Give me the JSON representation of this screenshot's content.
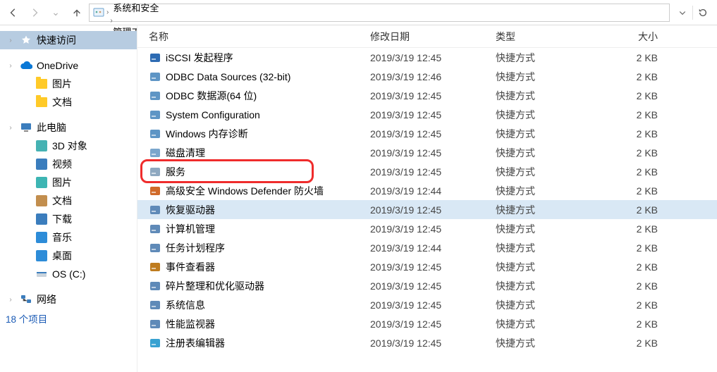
{
  "nav": {
    "back_enabled": true,
    "forward_enabled": false,
    "up_enabled": true,
    "refresh_enabled": true,
    "dropdown": "⌄",
    "crumbs": [
      "控制面板",
      "系统和安全",
      "管理工具"
    ]
  },
  "sidebar": {
    "items": [
      {
        "label": "快速访问",
        "icon": "star",
        "active": true,
        "expandable": true,
        "indent": false
      },
      {
        "label": "",
        "type": "spacer"
      },
      {
        "label": "OneDrive",
        "icon": "onedrive",
        "active": false,
        "expandable": true,
        "indent": false
      },
      {
        "label": "图片",
        "icon": "folder",
        "active": false,
        "expandable": false,
        "indent": true
      },
      {
        "label": "文档",
        "icon": "folder",
        "active": false,
        "expandable": false,
        "indent": true
      },
      {
        "label": "",
        "type": "spacer"
      },
      {
        "label": "此电脑",
        "icon": "pc",
        "active": false,
        "expandable": true,
        "indent": false
      },
      {
        "label": "3D 对象",
        "icon": "3d",
        "active": false,
        "expandable": false,
        "indent": true
      },
      {
        "label": "视频",
        "icon": "video",
        "active": false,
        "expandable": false,
        "indent": true
      },
      {
        "label": "图片",
        "icon": "pictures",
        "active": false,
        "expandable": false,
        "indent": true
      },
      {
        "label": "文档",
        "icon": "docs",
        "active": false,
        "expandable": false,
        "indent": true
      },
      {
        "label": "下载",
        "icon": "downloads",
        "active": false,
        "expandable": false,
        "indent": true
      },
      {
        "label": "音乐",
        "icon": "music",
        "active": false,
        "expandable": false,
        "indent": true
      },
      {
        "label": "桌面",
        "icon": "desktop",
        "active": false,
        "expandable": false,
        "indent": true
      },
      {
        "label": "OS (C:)",
        "icon": "drive",
        "active": false,
        "expandable": false,
        "indent": true
      },
      {
        "label": "",
        "type": "spacer"
      },
      {
        "label": "网络",
        "icon": "network",
        "active": false,
        "expandable": true,
        "indent": false
      }
    ],
    "status": "18 个项目"
  },
  "columns": {
    "name": "名称",
    "date": "修改日期",
    "type": "类型",
    "size": "大小"
  },
  "files": [
    {
      "name": "iSCSI 发起程序",
      "date": "2019/3/19 12:45",
      "type": "快捷方式",
      "size": "2 KB",
      "selected": false,
      "highlighted": false,
      "icon": "shield"
    },
    {
      "name": "ODBC Data Sources (32-bit)",
      "date": "2019/3/19 12:46",
      "type": "快捷方式",
      "size": "2 KB",
      "selected": false,
      "highlighted": false,
      "icon": "tool"
    },
    {
      "name": "ODBC 数据源(64 位)",
      "date": "2019/3/19 12:45",
      "type": "快捷方式",
      "size": "2 KB",
      "selected": false,
      "highlighted": false,
      "icon": "tool"
    },
    {
      "name": "System Configuration",
      "date": "2019/3/19 12:45",
      "type": "快捷方式",
      "size": "2 KB",
      "selected": false,
      "highlighted": false,
      "icon": "config"
    },
    {
      "name": "Windows 内存诊断",
      "date": "2019/3/19 12:45",
      "type": "快捷方式",
      "size": "2 KB",
      "selected": false,
      "highlighted": false,
      "icon": "memory"
    },
    {
      "name": "磁盘清理",
      "date": "2019/3/19 12:45",
      "type": "快捷方式",
      "size": "2 KB",
      "selected": false,
      "highlighted": false,
      "icon": "disk"
    },
    {
      "name": "服务",
      "date": "2019/3/19 12:45",
      "type": "快捷方式",
      "size": "2 KB",
      "selected": false,
      "highlighted": true,
      "icon": "gear"
    },
    {
      "name": "高级安全 Windows Defender 防火墙",
      "date": "2019/3/19 12:44",
      "type": "快捷方式",
      "size": "2 KB",
      "selected": false,
      "highlighted": false,
      "icon": "firewall"
    },
    {
      "name": "恢复驱动器",
      "date": "2019/3/19 12:45",
      "type": "快捷方式",
      "size": "2 KB",
      "selected": true,
      "highlighted": false,
      "icon": "recovery"
    },
    {
      "name": "计算机管理",
      "date": "2019/3/19 12:45",
      "type": "快捷方式",
      "size": "2 KB",
      "selected": false,
      "highlighted": false,
      "icon": "manage"
    },
    {
      "name": "任务计划程序",
      "date": "2019/3/19 12:44",
      "type": "快捷方式",
      "size": "2 KB",
      "selected": false,
      "highlighted": false,
      "icon": "task"
    },
    {
      "name": "事件查看器",
      "date": "2019/3/19 12:45",
      "type": "快捷方式",
      "size": "2 KB",
      "selected": false,
      "highlighted": false,
      "icon": "event"
    },
    {
      "name": "碎片整理和优化驱动器",
      "date": "2019/3/19 12:45",
      "type": "快捷方式",
      "size": "2 KB",
      "selected": false,
      "highlighted": false,
      "icon": "defrag"
    },
    {
      "name": "系统信息",
      "date": "2019/3/19 12:45",
      "type": "快捷方式",
      "size": "2 KB",
      "selected": false,
      "highlighted": false,
      "icon": "info"
    },
    {
      "name": "性能监视器",
      "date": "2019/3/19 12:45",
      "type": "快捷方式",
      "size": "2 KB",
      "selected": false,
      "highlighted": false,
      "icon": "perf"
    },
    {
      "name": "注册表编辑器",
      "date": "2019/3/19 12:45",
      "type": "快捷方式",
      "size": "2 KB",
      "selected": false,
      "highlighted": false,
      "icon": "reg"
    }
  ],
  "icons": {
    "star": "#f2f2f2",
    "onedrive": "#0a78d6",
    "folder": "#ffca28",
    "pc": "#3b7dbd",
    "3d": "#45b2b3",
    "video": "#3a7dbd",
    "pictures": "#3db5b3",
    "docs": "#c28e4e",
    "downloads": "#3b7dbd",
    "music": "#2d8cd8",
    "desktop": "#2d8cd8",
    "drive": "#9aa7b5",
    "network": "#2d8cd8",
    "shield": "#2d6bb3",
    "tool": "#5e95c5",
    "config": "#5e95c5",
    "memory": "#5e95c5",
    "disk": "#7aa6cc",
    "gear": "#8ea8c0",
    "firewall": "#d06a2a",
    "recovery": "#5f8ab8",
    "manage": "#5f8ab8",
    "task": "#5f8ab8",
    "event": "#bf7c1f",
    "defrag": "#5f8ab8",
    "info": "#5f8ab8",
    "perf": "#5f8ab8",
    "reg": "#37a1d1"
  }
}
